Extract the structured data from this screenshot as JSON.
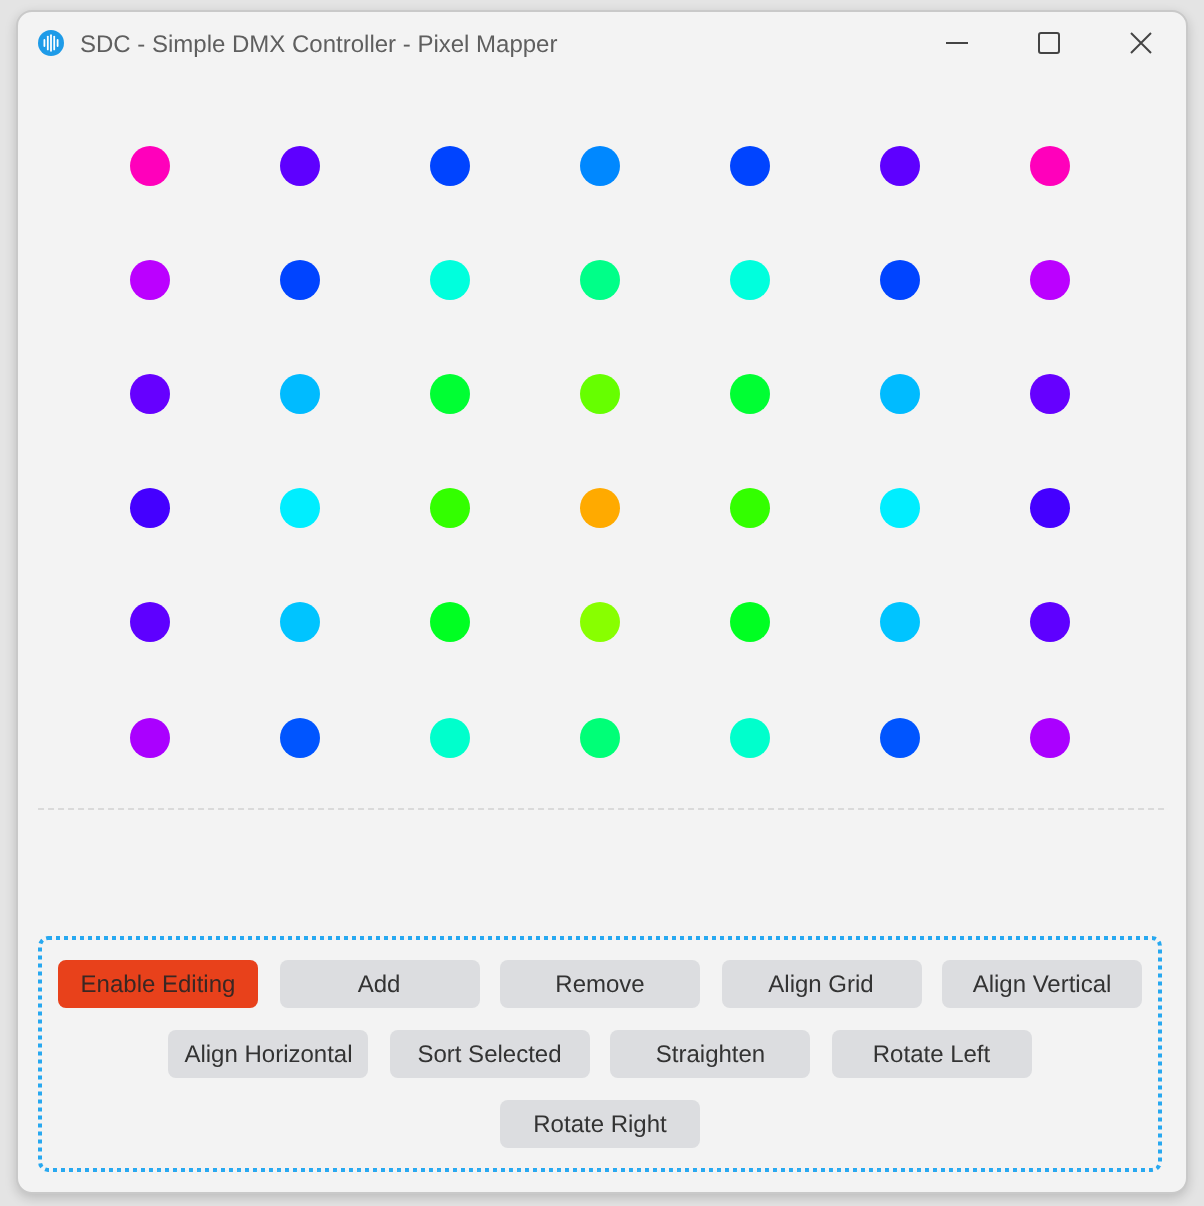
{
  "window": {
    "title": "SDC - Simple DMX Controller - Pixel Mapper"
  },
  "pixel_grid": {
    "rows": [
      [
        {
          "color": "#ff00bb"
        },
        {
          "color": "#5e00ff"
        },
        {
          "color": "#0044ff"
        },
        {
          "color": "#0088ff"
        },
        {
          "color": "#0044ff"
        },
        {
          "color": "#5e00ff"
        },
        {
          "color": "#ff00bb"
        }
      ],
      [
        {
          "color": "#bb00ff"
        },
        {
          "color": "#0044ff"
        },
        {
          "color": "#00ffdd"
        },
        {
          "color": "#00ff88"
        },
        {
          "color": "#00ffdd"
        },
        {
          "color": "#0044ff"
        },
        {
          "color": "#bb00ff"
        }
      ],
      [
        {
          "color": "#6600ff"
        },
        {
          "color": "#00bbff"
        },
        {
          "color": "#00ff33"
        },
        {
          "color": "#66ff00"
        },
        {
          "color": "#00ff33"
        },
        {
          "color": "#00bbff"
        },
        {
          "color": "#6600ff"
        }
      ],
      [
        {
          "color": "#4400ff"
        },
        {
          "color": "#00eeff"
        },
        {
          "color": "#33ff00"
        },
        {
          "color": "#ffaa00"
        },
        {
          "color": "#33ff00"
        },
        {
          "color": "#00eeff"
        },
        {
          "color": "#4400ff"
        }
      ],
      [
        {
          "color": "#5e00ff"
        },
        {
          "color": "#00c4ff"
        },
        {
          "color": "#00ff22"
        },
        {
          "color": "#88ff00"
        },
        {
          "color": "#00ff22"
        },
        {
          "color": "#00c4ff"
        },
        {
          "color": "#5e00ff"
        }
      ],
      [
        {
          "color": "#aa00ff"
        },
        {
          "color": "#0055ff"
        },
        {
          "color": "#00ffcc"
        },
        {
          "color": "#00ff77"
        },
        {
          "color": "#00ffcc"
        },
        {
          "color": "#0055ff"
        },
        {
          "color": "#aa00ff"
        }
      ]
    ]
  },
  "button_rows": [
    [
      {
        "label": "Enable Editing",
        "kind": "accent"
      },
      {
        "label": "Add",
        "kind": "plain"
      },
      {
        "label": "Remove",
        "kind": "plain"
      },
      {
        "label": "Align Grid",
        "kind": "plain"
      },
      {
        "label": "Align Vertical",
        "kind": "plain"
      }
    ],
    [
      {
        "label": "Align Horizontal",
        "kind": "plain"
      },
      {
        "label": "Sort Selected",
        "kind": "plain"
      },
      {
        "label": "Straighten",
        "kind": "plain"
      },
      {
        "label": "Rotate Left",
        "kind": "plain"
      }
    ],
    [
      {
        "label": "Rotate Right",
        "kind": "plain"
      }
    ]
  ]
}
